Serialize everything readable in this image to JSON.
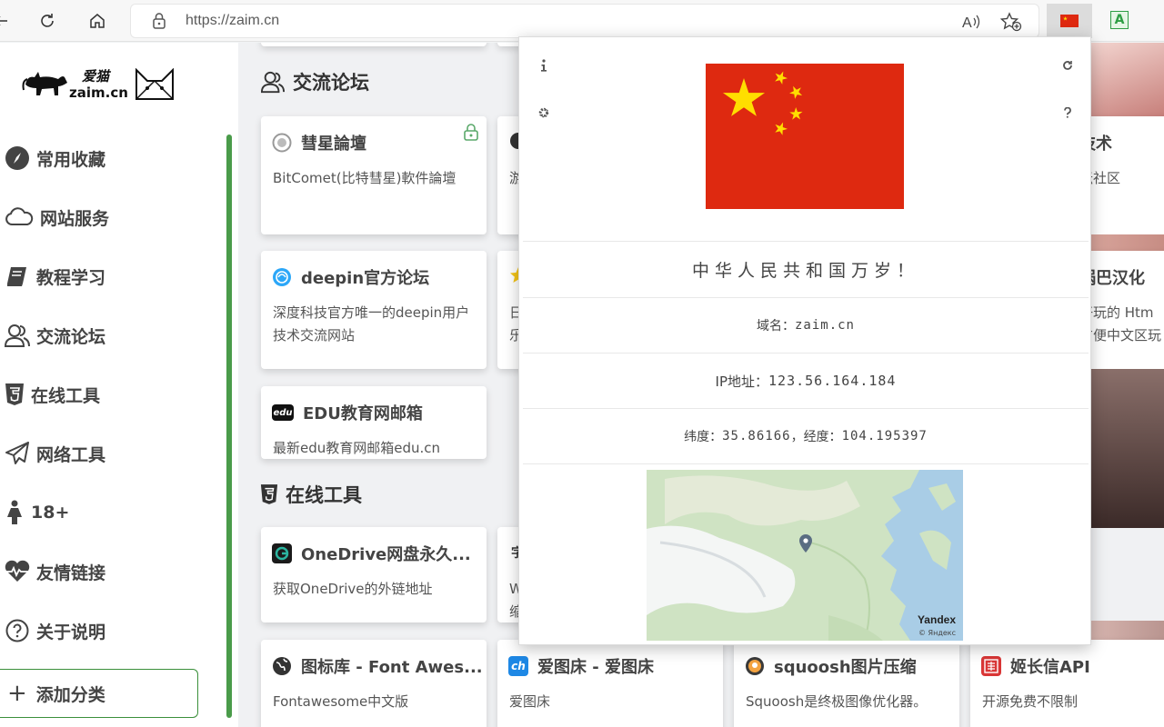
{
  "browser": {
    "url": "https://zaim.cn"
  },
  "sidebar": {
    "logo_text_cn": "爱猫",
    "logo_text_en": "zaim.cn",
    "items": [
      {
        "label": "常用收藏",
        "icon": "compass-icon"
      },
      {
        "label": "网站服务",
        "icon": "cloud-icon"
      },
      {
        "label": "教程学习",
        "icon": "book-icon"
      },
      {
        "label": "交流论坛",
        "icon": "users-icon"
      },
      {
        "label": "在线工具",
        "icon": "html5-icon"
      },
      {
        "label": "网络工具",
        "icon": "paper-plane-icon"
      },
      {
        "label": "18+",
        "icon": "female-icon"
      },
      {
        "label": "友情链接",
        "icon": "heartbeat-icon"
      },
      {
        "label": "关于说明",
        "icon": "question-circle-icon"
      }
    ],
    "add_category": "添加分类"
  },
  "main": {
    "section_forum": "交流论坛",
    "section_tools": "在线工具",
    "forum_cards": [
      {
        "title": "彗星論壇",
        "desc": "BitComet(比特彗星)軟件論壇"
      },
      {
        "title": "deepin官方论坛",
        "desc": "深度科技官方唯一的deepin用户技术交流网站"
      },
      {
        "title": "EDU教育网邮箱",
        "desc": "最新edu教育网邮箱edu.cn"
      }
    ],
    "tool_cards": [
      {
        "title": "OneDrive网盘永久...",
        "desc": "获取OneDrive的外链地址"
      },
      {
        "title": "图标库 - Font Awes...",
        "desc": "Fontawesome中文版"
      },
      {
        "title": "爱图床 - 爱图床",
        "desc": "爱图床"
      },
      {
        "title": "squoosh图片压缩",
        "desc": "Squoosh是终极图像优化器。"
      },
      {
        "title": "姬长信API",
        "desc": "开源免费不限制"
      }
    ],
    "partial_fragments": {
      "col2_row1": "游",
      "col2_row2a": "日",
      "col2_row2b": "乐",
      "col2_tools_a": "W",
      "col2_tools_b": "缩",
      "col4_row1_title": "技术",
      "col4_row1_desc": "坛社区",
      "col4_row2_title": "锅巴汉化",
      "col4_row2_desc1": "好玩的 Htm",
      "col4_row2_desc2": "方便中文区玩"
    }
  },
  "popup": {
    "motto": "中华人民共和国万岁！",
    "domain_label": "域名：",
    "domain_value": "zaim.cn",
    "ip_label": "IP地址：",
    "ip_value": "123.56.164.184",
    "lat_label": "纬度：",
    "lat_value": "35.86166",
    "sep": "，",
    "lng_label": "经度：",
    "lng_value": "104.195397",
    "map_brand": "Yandex",
    "map_brand_sub": "© Яндекс",
    "flag_colors": {
      "red": "#de2910",
      "yellow": "#ffde00"
    }
  }
}
